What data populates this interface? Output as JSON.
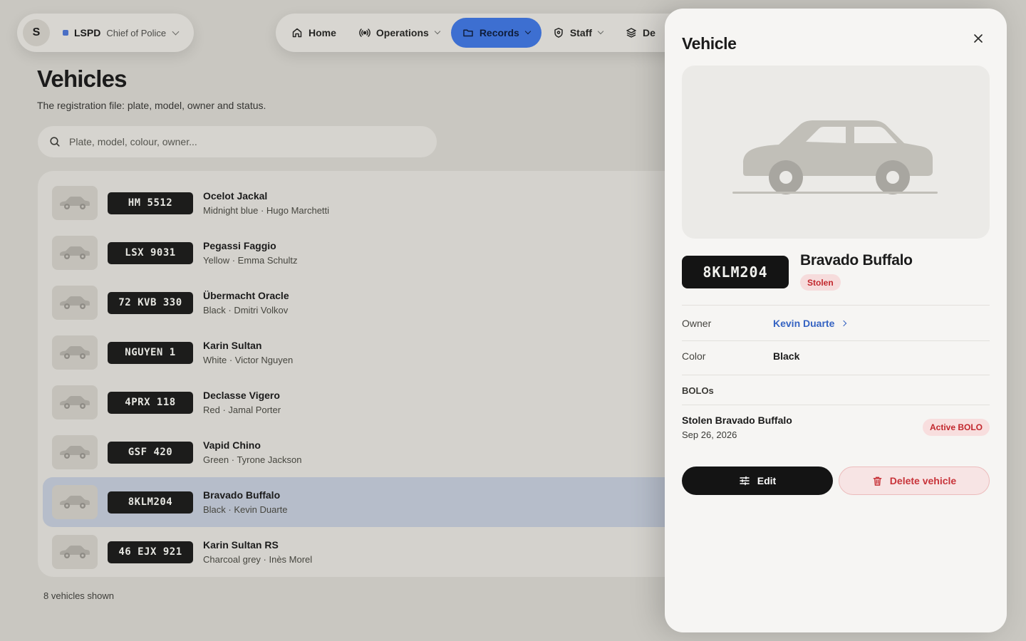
{
  "org": {
    "avatar_initial": "S",
    "name": "LSPD",
    "role": "Chief of Police"
  },
  "nav": {
    "items": [
      {
        "label": "Home",
        "icon": "home-icon",
        "active": false
      },
      {
        "label": "Operations",
        "icon": "radio-icon",
        "active": false
      },
      {
        "label": "Records",
        "icon": "folder-icon",
        "active": true
      },
      {
        "label": "Staff",
        "icon": "shield-icon",
        "active": false
      },
      {
        "label": "De",
        "icon": "layers-icon",
        "active": false
      }
    ]
  },
  "page": {
    "title": "Vehicles",
    "subtitle": "The registration file: plate, model, owner and status."
  },
  "search": {
    "placeholder": "Plate, model, colour, owner..."
  },
  "vehicles": [
    {
      "plate": "HM 5512",
      "model": "Ocelot Jackal",
      "desc": "Midnight blue · Hugo Marchetti"
    },
    {
      "plate": "LSX 9031",
      "model": "Pegassi Faggio",
      "desc": "Yellow · Emma Schultz"
    },
    {
      "plate": "72 KVB 330",
      "model": "Übermacht Oracle",
      "desc": "Black · Dmitri Volkov"
    },
    {
      "plate": "NGUYEN 1",
      "model": "Karin Sultan",
      "desc": "White · Victor Nguyen"
    },
    {
      "plate": "4PRX 118",
      "model": "Declasse Vigero",
      "desc": "Red · Jamal Porter"
    },
    {
      "plate": "GSF 420",
      "model": "Vapid Chino",
      "desc": "Green · Tyrone Jackson"
    },
    {
      "plate": "8KLM204",
      "model": "Bravado Buffalo",
      "desc": "Black · Kevin Duarte",
      "selected": true
    },
    {
      "plate": "46 EJX 921",
      "model": "Karin Sultan RS",
      "desc": "Charcoal grey · Inès Morel"
    }
  ],
  "list_footer": "8 vehicles shown",
  "drawer": {
    "title": "Vehicle",
    "plate": "8KLM204",
    "model": "Bravado Buffalo",
    "status": "Stolen",
    "owner_label": "Owner",
    "owner": "Kevin Duarte",
    "color_label": "Color",
    "color": "Black",
    "bolos_label": "BOLOs",
    "bolo": {
      "title": "Stolen Bravado Buffalo",
      "date": "Sep 26, 2026",
      "status": "Active BOLO"
    },
    "edit_label": "Edit",
    "delete_label": "Delete vehicle"
  },
  "colors": {
    "accent": "#3d6fd1",
    "danger": "#c2272d",
    "plate_bg": "#1c1c1b"
  }
}
